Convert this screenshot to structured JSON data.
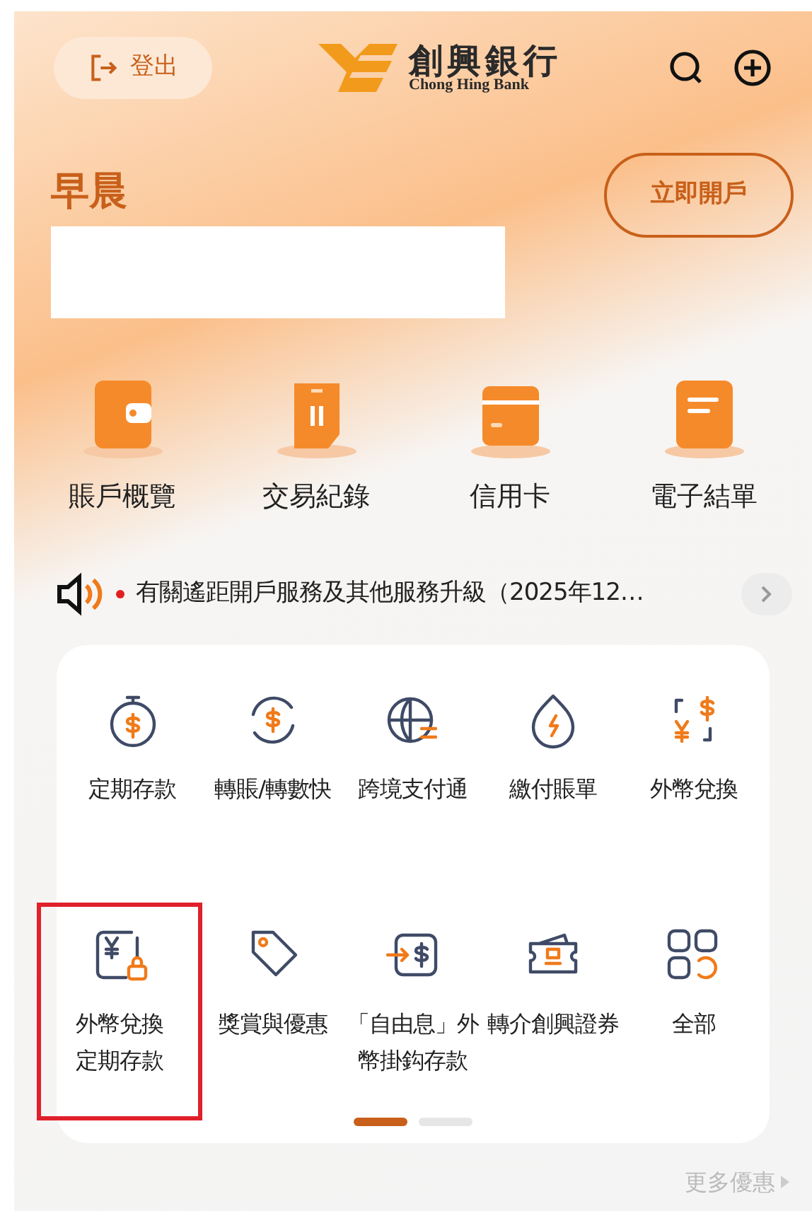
{
  "header": {
    "logout_label": "登出",
    "logo_text": "創興銀行",
    "logo_subtext": "Chong Hing Bank"
  },
  "greeting": "早晨",
  "open_account_button": "立即開戶",
  "quick_actions": [
    {
      "label": "賬戶概覽"
    },
    {
      "label": "交易紀錄"
    },
    {
      "label": "信用卡"
    },
    {
      "label": "電子結單"
    }
  ],
  "notice": {
    "text": "有關遙距開戶服務及其他服務升級（2025年12…",
    "unread": true
  },
  "services": [
    {
      "label": "定期存款",
      "highlighted": false
    },
    {
      "label": "轉賬/轉數快",
      "highlighted": false
    },
    {
      "label": "跨境支付通",
      "highlighted": false
    },
    {
      "label": "繳付賬單",
      "highlighted": false
    },
    {
      "label": "外幣兌換",
      "highlighted": false
    },
    {
      "label": "外幣兌換定期存款",
      "highlighted": true
    },
    {
      "label": "獎賞與優惠",
      "highlighted": false
    },
    {
      "label": "「自由息」外幣掛鈎存款",
      "highlighted": false
    },
    {
      "label": "轉介創興證券",
      "highlighted": false
    },
    {
      "label": "全部",
      "highlighted": false
    }
  ],
  "pages": [
    {
      "selected": true
    },
    {
      "selected": false
    }
  ],
  "more_offers": "更多優惠"
}
